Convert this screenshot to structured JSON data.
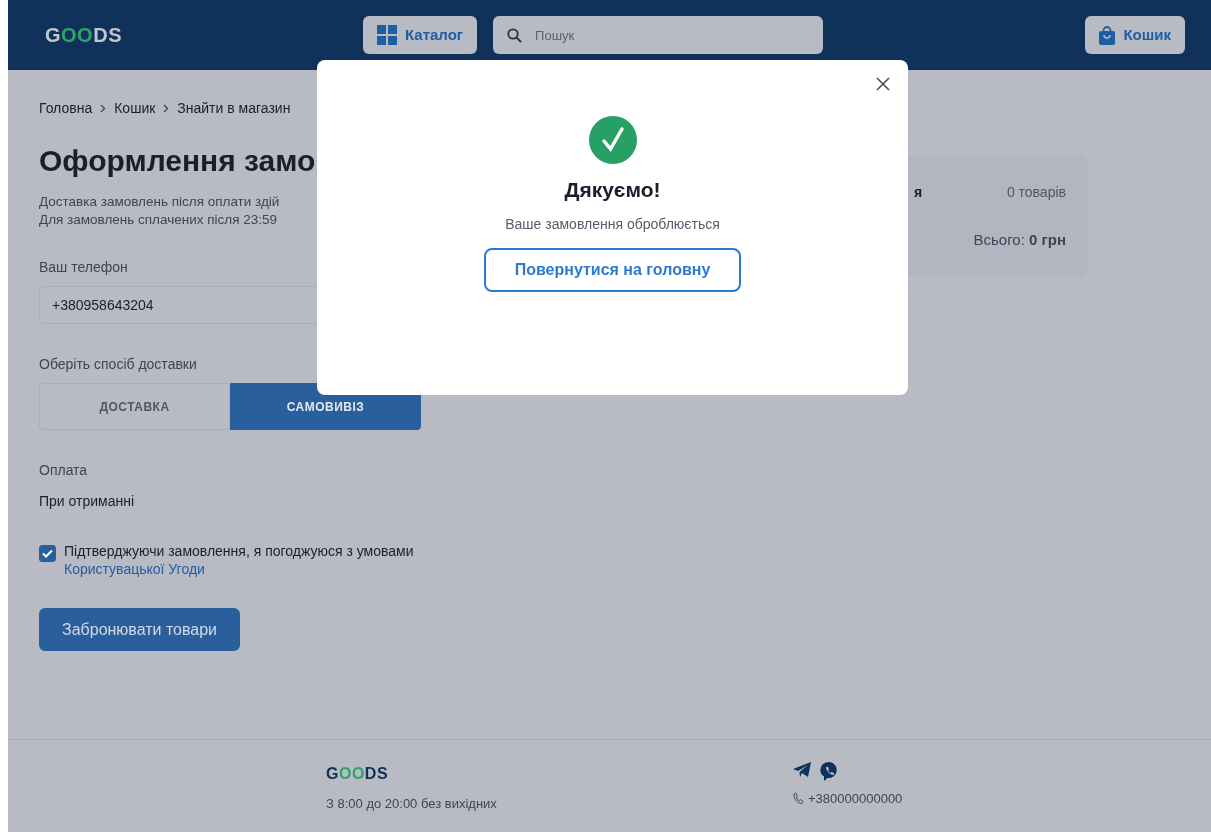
{
  "header": {
    "logo": [
      {
        "text": "G",
        "accent": false
      },
      {
        "text": "OO",
        "accent": true
      },
      {
        "text": "DS",
        "accent": false
      }
    ],
    "catalog_button": "Каталог",
    "search": {
      "placeholder": "Пошук"
    },
    "cart_button": "Кошик"
  },
  "breadcrumbs": [
    "Головна",
    "Кошик",
    "Знайти в магазин"
  ],
  "page_title": "Оформлення замо",
  "notes": [
    "Доставка замовлень після оплати здій",
    "Для замовлень сплачених після 23:59"
  ],
  "phone": {
    "label": "Ваш телефон",
    "value": "+380958643204"
  },
  "delivery": {
    "label": "Оберіть спосіб доставки",
    "options": [
      {
        "label": "ДОСТАВКА",
        "selected": false
      },
      {
        "label": "САМОВИВІЗ",
        "selected": true
      }
    ]
  },
  "payment": {
    "label": "Оплата",
    "value": "При отриманні"
  },
  "agreement": {
    "checked": true,
    "text": "Підтверджуючи замовлення, я погоджуюся з умовами",
    "link": "Користувацької Угоди"
  },
  "submit_button": "Забронювати товари",
  "summary": {
    "title_fragment": "я",
    "count": "0 товарів",
    "total": "Всього: **0 грн**"
  },
  "footer": {
    "logo": [
      {
        "text": "G",
        "accent": false
      },
      {
        "text": "OO",
        "accent": true
      },
      {
        "text": "DS",
        "accent": false
      }
    ],
    "hours": "З 8:00 до 20:00 без вихідних",
    "phone": "+380000000000"
  },
  "modal": {
    "title": "Дякуємо!",
    "message": "Ваше замовлення оброблюється",
    "button": "Повернутися на головну"
  }
}
